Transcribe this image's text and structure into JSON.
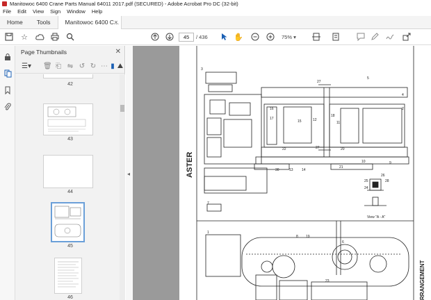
{
  "window": {
    "title": "Manitowoc 6400 Crane Parts Manual 64011 2017.pdf (SECURED) - Adobe Acrobat Pro DC (32-bit)"
  },
  "menu": [
    "File",
    "Edit",
    "View",
    "Sign",
    "Window",
    "Help"
  ],
  "tabs": {
    "home": "Home",
    "tools": "Tools",
    "document": "Manitowoc 6400 C..."
  },
  "toolbar": {
    "current_page": "45",
    "total_pages": "/ 436",
    "zoom": "75%"
  },
  "panel": {
    "title": "Page Thumbnails",
    "thumbnails": [
      {
        "label": "42"
      },
      {
        "label": "43"
      },
      {
        "label": "44"
      },
      {
        "label": "45",
        "selected": true
      },
      {
        "label": "46"
      }
    ]
  },
  "document": {
    "rotated_text_left": "ASTER",
    "rotated_text_right": "RRANGEMENT",
    "view_label": "View \"A - A\"",
    "callouts": [
      "1",
      "2",
      "3",
      "4",
      "5",
      "6",
      "7",
      "8",
      "9",
      "10",
      "11",
      "12",
      "13",
      "14",
      "15",
      "16",
      "17",
      "18",
      "19",
      "20",
      "21",
      "22",
      "23",
      "24",
      "25",
      "26",
      "27",
      "28",
      "30"
    ]
  }
}
